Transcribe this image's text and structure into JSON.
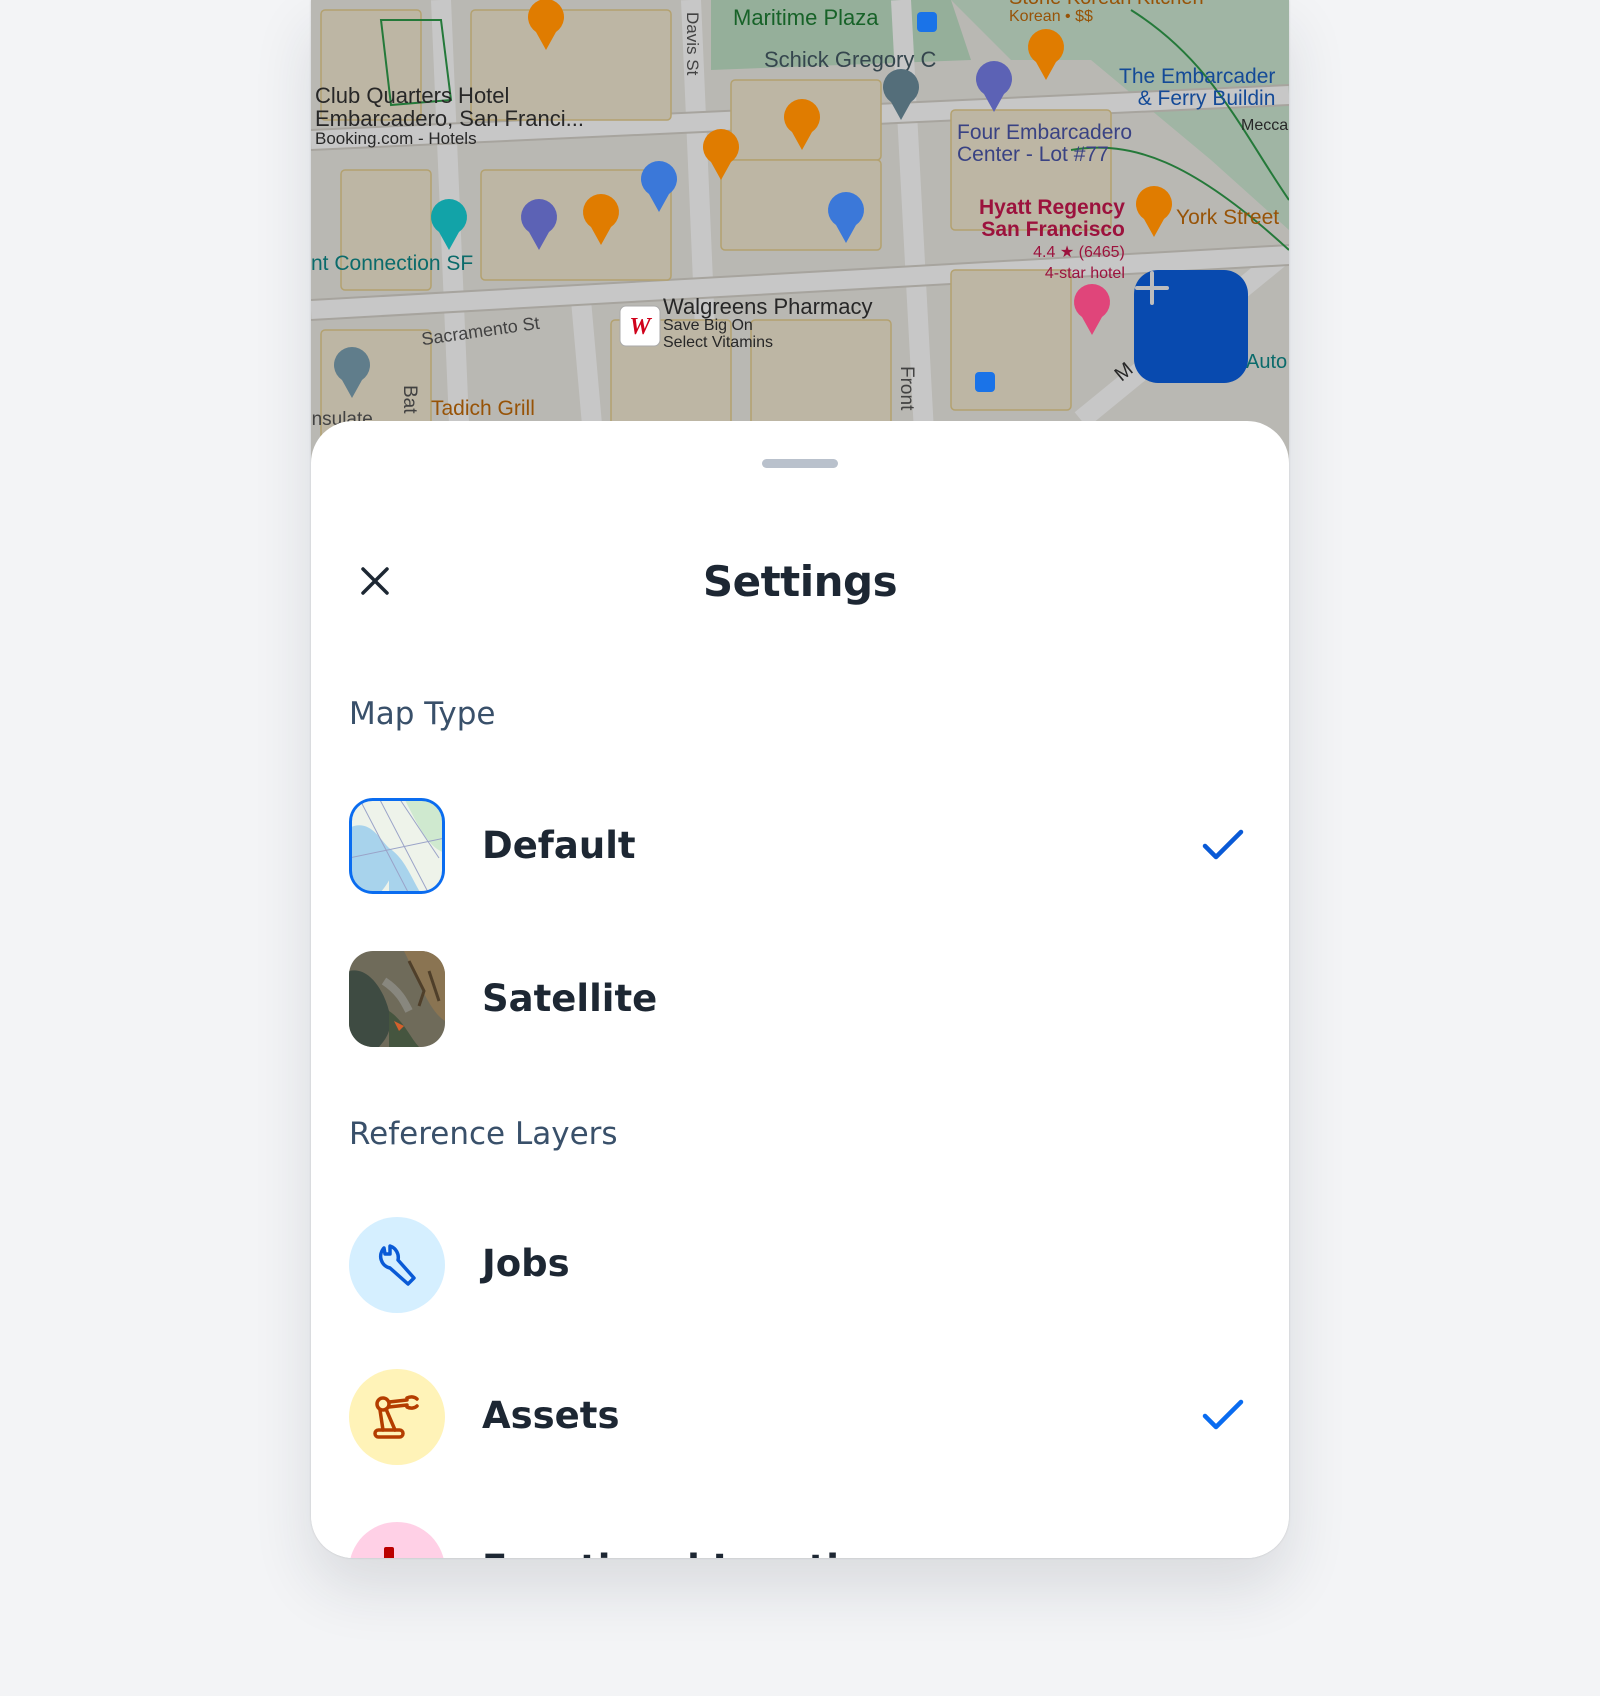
{
  "map": {
    "labels": {
      "club_quarters_1": "Club Quarters Hotel",
      "club_quarters_2": "Embarcadero, San Franci...",
      "club_quarters_3": "Booking.com - Hotels",
      "maritime_plaza": "Maritime Plaza",
      "schick": "Schick Gregory C",
      "stone_korean": "Stone Korean Kitchen",
      "stone_korean_sub": "Korean • $$",
      "embarcadero_1": "The Embarcader",
      "embarcadero_2": "& Ferry Buildin",
      "mecca": "Mecca",
      "four_embarcadero_1": "Four Embarcadero",
      "four_embarcadero_2": "Center - Lot #77",
      "hyatt_1": "Hyatt Regency",
      "hyatt_2": "San Francisco",
      "hyatt_rating": "4.4 ★ (6465)",
      "hyatt_class": "4-star hotel",
      "york_street": "York Street",
      "connection_sf": "nt Connection SF",
      "sacramento_st": "Sacramento St",
      "walgreens_1": "Walgreens Pharmacy",
      "walgreens_2": "Save Big On",
      "walgreens_3": "Select Vitamins",
      "tadich": "Tadich Grill",
      "davis_st": "Davis St",
      "front_st": "Front",
      "battery_st": "Bat",
      "consulate": "onsulate",
      "auto": "Auto",
      "market": "M"
    },
    "fab": {
      "icon": "plus-icon"
    }
  },
  "sheet": {
    "title": "Settings",
    "close_icon": "close-icon",
    "map_type": {
      "label": "Map Type",
      "options": [
        {
          "label": "Default",
          "thumbnail": "map-thumbnail-default",
          "selected": true
        },
        {
          "label": "Satellite",
          "thumbnail": "map-thumbnail-satellite",
          "selected": false
        }
      ]
    },
    "reference_layers": {
      "label": "Reference Layers",
      "items": [
        {
          "label": "Jobs",
          "icon": "wrench-icon",
          "bg": "#d5efff",
          "fg": "#0a5ad6",
          "checked": false
        },
        {
          "label": "Assets",
          "icon": "robot-arm-icon",
          "bg": "#fff3b8",
          "fg": "#b43d00",
          "checked": true
        },
        {
          "label": "Functional Locations",
          "icon": "location-icon",
          "bg": "#ffd0e6",
          "fg": "#bb0000",
          "checked": false
        }
      ]
    },
    "accent_color": "#0a6cf0"
  }
}
